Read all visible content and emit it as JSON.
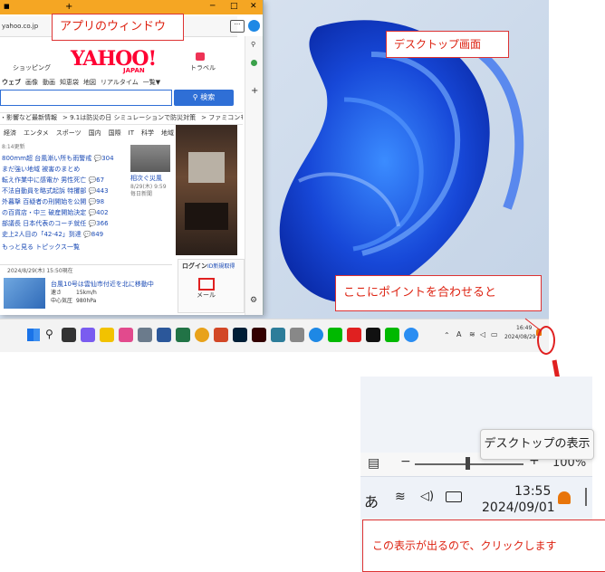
{
  "browser": {
    "url": "yahoo.co.jp",
    "tab_plus": "+",
    "logo": "YAHOO!",
    "logo_sub": "JAPAN",
    "nav_left": "ショッピング",
    "nav_right": "トラベル",
    "search_tabs": [
      "ウェブ",
      "画像",
      "動画",
      "知恵袋",
      "地図",
      "リアルタイム",
      "一覧▼"
    ],
    "search_button": "検索",
    "ticker": [
      "・影響など最新情報",
      "> 9.1は防災の日 シミュレーションで防災対策",
      "> ファミコンも出品中"
    ],
    "categories": [
      "経済",
      "エンタメ",
      "スポーツ",
      "国内",
      "国際",
      "IT",
      "科学",
      "地域"
    ],
    "time_label": "8:14更新",
    "news": [
      "800mm超 台風漸い所も雨警戒 💬304",
      "まだ強い地域 被害のまとめ",
      "転え作業中に感電か 男性死亡 💬67",
      "不法自動員を略式起訴 特攫部 💬443",
      "外暮撃 百疑者の刑開始を公開 💬98",
      "の百貨店・中三 破産開始決定 💬402",
      "部議長 日本代表のコーチ就任 💬366",
      "史上2人目の「42-42」到達 💬849"
    ],
    "news_more": "もっと見る トピックス一覧",
    "photo_caption": "相次ぐ災風",
    "photo_date": "8/29(木) 9:59",
    "photo_source": "毎日新聞",
    "weather_date": "2024/8/29(木) 15:50現在",
    "weather_headline": "台風10号は雲仙市付近を北に移動中",
    "weather_speed_label": "速さ",
    "weather_speed": "15km/h",
    "weather_direction_label": "中心気圧",
    "weather_direction": "980hPa",
    "login_label": "ログイン",
    "login_sub": "ID新規取得",
    "mail_label": "メール"
  },
  "taskbar": {
    "tray_time": "16:49",
    "tray_date": "2024/08/29",
    "tray_lang": "A"
  },
  "zoom": {
    "tooltip": "デスクトップの表示",
    "minus": "−",
    "plus": "+",
    "zoom_level": "100%",
    "lang": "あ",
    "time": "13:55",
    "date": "2024/09/01"
  },
  "callouts": {
    "app_window": "アプリのウィンドウ",
    "desktop": "デスクトップ画面",
    "point_here": "ここにポイントを合わせると",
    "click_here": "この表示が出るので、クリックします"
  },
  "colors": {
    "accent_red": "#e02020",
    "yahoo_red": "#ff0033",
    "search_blue": "#2f6fd6"
  }
}
